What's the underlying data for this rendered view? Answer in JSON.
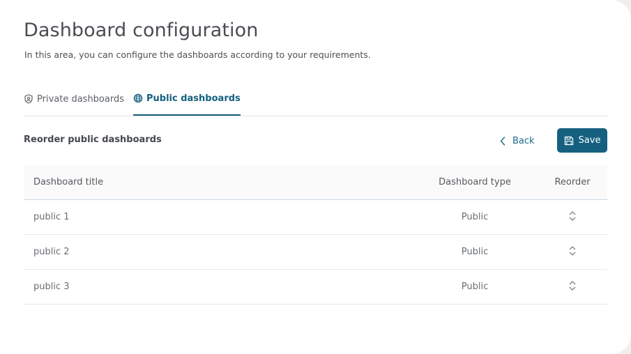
{
  "page": {
    "title": "Dashboard configuration",
    "description": "In this area, you can configure the dashboards according to your requirements."
  },
  "tabs": [
    {
      "label": "Private dashboards",
      "icon": "shield-user-icon",
      "active": false
    },
    {
      "label": "Public dashboards",
      "icon": "globe-icon",
      "active": true
    }
  ],
  "section": {
    "title": "Reorder public dashboards",
    "back_label": "Back",
    "save_label": "Save"
  },
  "table": {
    "columns": [
      "Dashboard title",
      "Dashboard type",
      "Reorder"
    ],
    "rows": [
      {
        "title": "public 1",
        "type": "Public",
        "reorder_icon": "reorder-icon"
      },
      {
        "title": "public 2",
        "type": "Public",
        "reorder_icon": "reorder-icon"
      },
      {
        "title": "public 3",
        "type": "Public",
        "reorder_icon": "reorder-icon"
      }
    ]
  },
  "colors": {
    "accent": "#15607f",
    "title_text": "#4a4d52",
    "body_text": "#6a6e73",
    "header_divider": "#cbd9e4"
  }
}
